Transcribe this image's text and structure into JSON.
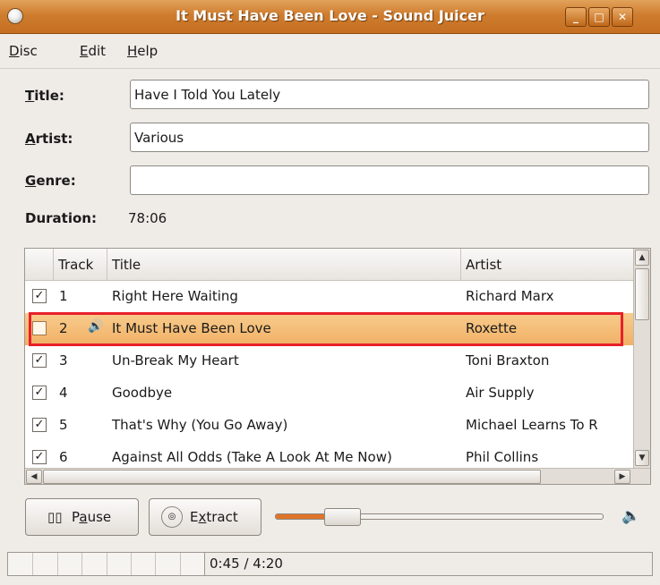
{
  "window": {
    "title": "It Must Have Been Love - Sound Juicer",
    "minimize_glyph": "_",
    "maximize_glyph": "□",
    "close_glyph": "✕"
  },
  "menu": {
    "disc": {
      "mnemonic": "D",
      "rest": "isc"
    },
    "edit": {
      "mnemonic": "E",
      "rest": "dit"
    },
    "help": {
      "mnemonic": "H",
      "rest": "elp"
    }
  },
  "form": {
    "title_label": {
      "mnemonic": "T",
      "rest": "itle:"
    },
    "title_value": "Have I Told You Lately",
    "artist_label": {
      "mnemonic": "A",
      "rest": "rtist:"
    },
    "artist_value": "Various",
    "genre_label": {
      "mnemonic": "G",
      "rest": "enre:"
    },
    "genre_value": "",
    "duration_label": "Duration:",
    "duration_value": "78:06"
  },
  "tracklist": {
    "columns": {
      "track": "Track",
      "title": "Title",
      "artist": "Artist"
    },
    "rows": [
      {
        "checked": true,
        "number": "1",
        "title": "Right Here Waiting",
        "artist": "Richard Marx",
        "playing": false
      },
      {
        "checked": false,
        "number": "2",
        "title": "It Must Have Been Love",
        "artist": "Roxette",
        "playing": true
      },
      {
        "checked": true,
        "number": "3",
        "title": "Un-Break My Heart",
        "artist": "Toni Braxton",
        "playing": false
      },
      {
        "checked": true,
        "number": "4",
        "title": "Goodbye",
        "artist": "Air Supply",
        "playing": false
      },
      {
        "checked": true,
        "number": "5",
        "title": "That's Why (You Go Away)",
        "artist": "Michael Learns To R",
        "playing": false
      },
      {
        "checked": true,
        "number": "6",
        "title": "Against All Odds (Take A Look At Me Now)",
        "artist": "Phil Collins",
        "playing": false
      }
    ],
    "selected_index": 1,
    "check_glyph": "✓",
    "speaker_glyph": "🔊"
  },
  "controls": {
    "pause_label": {
      "before": "P",
      "mnemonic": "a",
      "rest": "use"
    },
    "extract_label": {
      "before": "E",
      "mnemonic": "x",
      "rest": "tract"
    },
    "seek_fraction": 0.17,
    "accent_color": "#e07428"
  },
  "status": {
    "time": "0:45 / 4:20",
    "progress_segments": 8
  }
}
